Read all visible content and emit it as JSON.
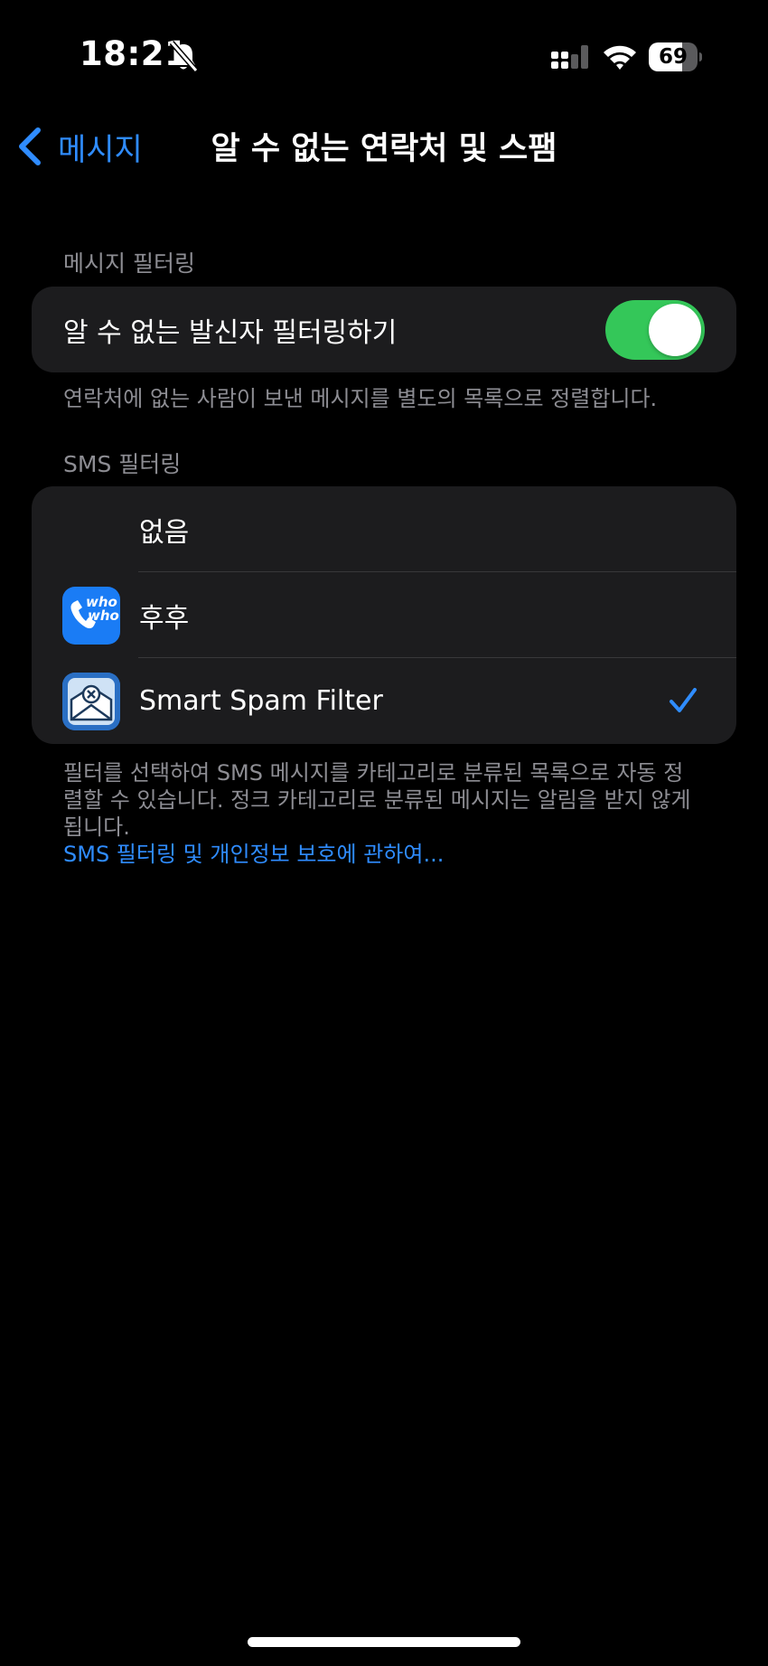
{
  "status_bar": {
    "time": "18:21",
    "battery_level": "69",
    "battery_percent": 69
  },
  "nav": {
    "back_label": "메시지",
    "title": "알 수 없는 연락처 및 스팸"
  },
  "message_filtering": {
    "header": "메시지 필터링",
    "toggle_label": "알 수 없는 발신자 필터링하기",
    "toggle_on": true,
    "footer": "연락처에 없는 사람이 보낸 메시지를 별도의 목록으로 정렬합니다."
  },
  "sms_filtering": {
    "header": "SMS 필터링",
    "options": [
      {
        "label": "없음",
        "icon": "none",
        "selected": false
      },
      {
        "label": "후후",
        "icon": "whowho-app-icon",
        "icon_text": "who who",
        "selected": false
      },
      {
        "label": "Smart Spam Filter",
        "icon": "smart-spam-filter-app-icon",
        "selected": true
      }
    ],
    "footer": "필터를 선택하여 SMS 메시지를 카테고리로 분류된 목록으로 자동 정렬할 수 있습니다. 정크 카테고리로 분류된 메시지는 알림을 받지 않게 됩니다.",
    "link": "SMS 필터링 및 개인정보 보호에 관하여..."
  },
  "colors": {
    "accent": "#2f8cff",
    "toggle_on": "#34c759",
    "card_bg": "#1c1c1e",
    "secondary_text": "#8d8d93"
  }
}
